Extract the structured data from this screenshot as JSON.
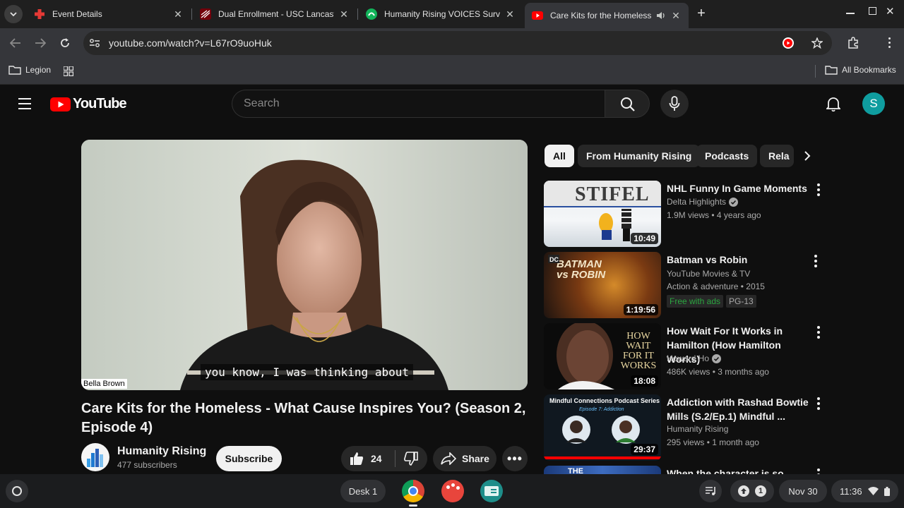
{
  "browser": {
    "tabs": [
      {
        "title": "Event Details",
        "favicon": "red-cross-icon"
      },
      {
        "title": "Dual Enrollment - USC Lancaster",
        "favicon": "usc-logo-icon"
      },
      {
        "title": "Humanity Rising VOICES Survey",
        "favicon": "survey-icon"
      },
      {
        "title": "Care Kits for the Homeless",
        "favicon": "youtube-icon",
        "active": true
      }
    ],
    "url": "youtube.com/watch?v=L67rO9uoHuk",
    "bookmarks": {
      "folder": "Legion",
      "all": "All Bookmarks"
    }
  },
  "youtube": {
    "logo_text": "YouTube",
    "search_placeholder": "Search",
    "avatar_letter": "S",
    "accent": "#ff0000",
    "avatar_color": "#0f9d9f",
    "video": {
      "caption": "you know, I was thinking about",
      "speaker_tag": "Bella Brown",
      "title": "Care Kits for the Homeless - What Cause Inspires You? (Season 2, Episode 4)",
      "channel": "Humanity Rising",
      "subscribers": "477 subscribers",
      "subscribe_label": "Subscribe",
      "likes": "24",
      "share_label": "Share"
    },
    "chips": [
      "All",
      "From Humanity Rising",
      "Podcasts",
      "Rela"
    ],
    "recommendations": [
      {
        "title": "NHL Funny In Game Moments",
        "channel": "Delta Highlights",
        "verified": true,
        "meta": "1.9M views • 4 years ago",
        "duration": "10:49",
        "thumb_text": "STIFEL"
      },
      {
        "title": "Batman vs Robin",
        "channel": "YouTube Movies & TV",
        "meta": "Action & adventure • 2015",
        "badge_free": "Free with ads",
        "badge_rating": "PG-13",
        "duration": "1:19:56",
        "thumb_text": "BATMAN vs ROBIN"
      },
      {
        "title": "How Wait For It Works in Hamilton (How Hamilton Works)",
        "channel": "Howard Ho",
        "verified": true,
        "meta": "486K views • 3 months ago",
        "duration": "18:08",
        "thumb_text": "HOW WAIT FOR IT WORKS"
      },
      {
        "title": "Addiction with Rashad Bowtie Mills (S.2/Ep.1) Mindful ...",
        "channel": "Humanity Rising",
        "meta": "295 views • 1 month ago",
        "duration": "29:37",
        "thumb_text": "Mindful Connections Podcast Series",
        "thumb_sub": "Episode 7: Addiction"
      },
      {
        "title": "When the character is so boring.",
        "thumb_text": "THE"
      }
    ]
  },
  "shelf": {
    "desk": "Desk 1",
    "notification_count": "1",
    "date": "Nov 30",
    "time": "11:36"
  }
}
